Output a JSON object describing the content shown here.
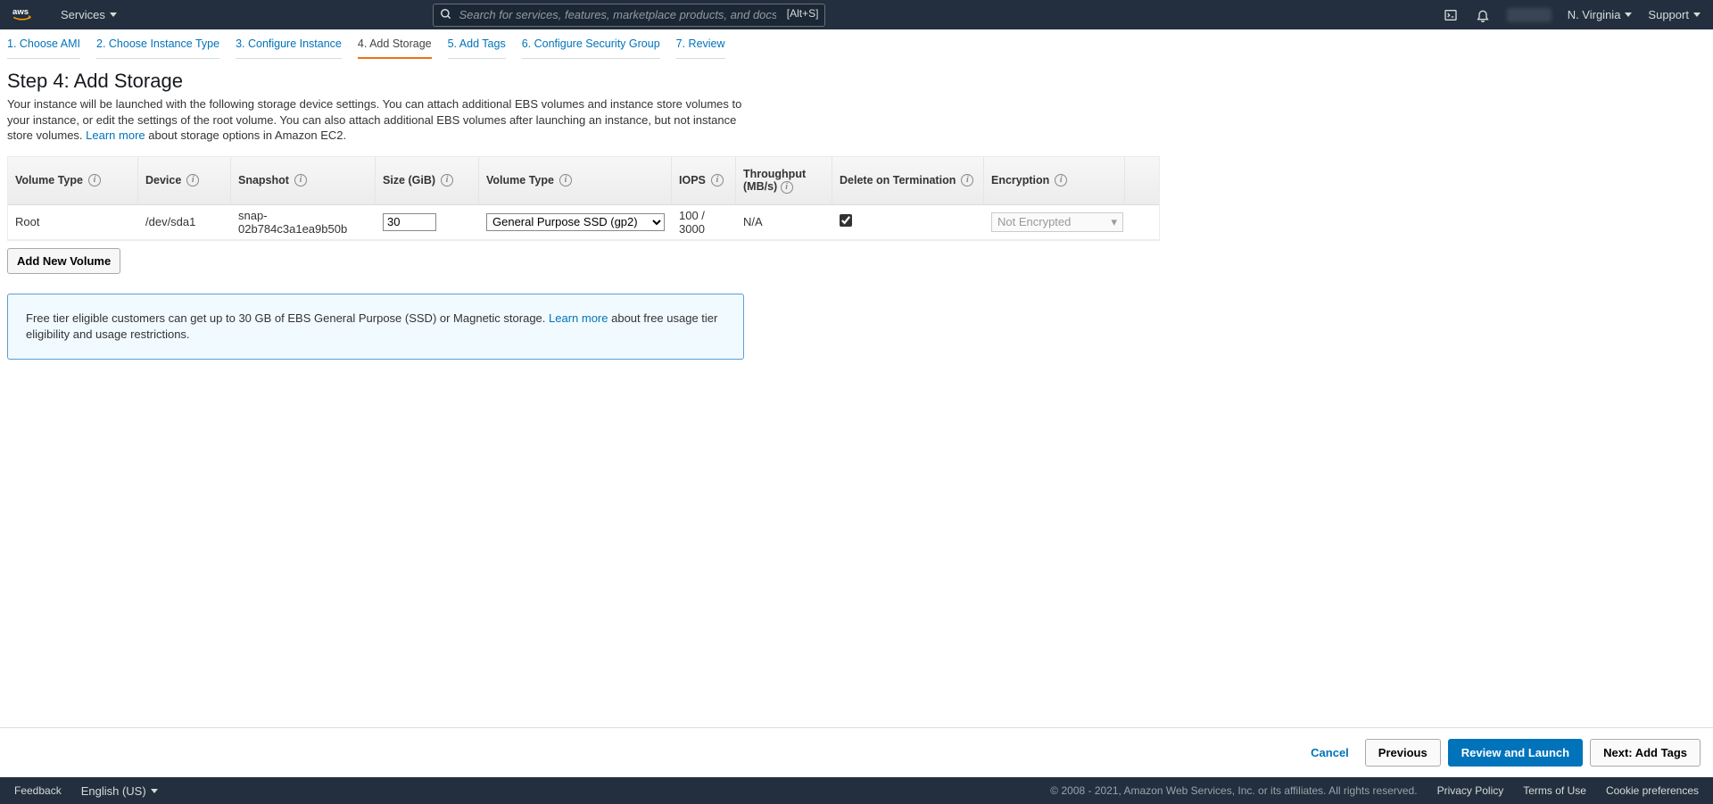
{
  "nav": {
    "services": "Services",
    "search_placeholder": "Search for services, features, marketplace products, and docs",
    "shortcut": "[Alt+S]",
    "region": "N. Virginia",
    "support": "Support"
  },
  "wizard": {
    "steps": [
      "1. Choose AMI",
      "2. Choose Instance Type",
      "3. Configure Instance",
      "4. Add Storage",
      "5. Add Tags",
      "6. Configure Security Group",
      "7. Review"
    ],
    "active_index": 3
  },
  "page": {
    "title": "Step 4: Add Storage",
    "lead_a": "Your instance will be launched with the following storage device settings. You can attach additional EBS volumes and instance store volumes to your instance, or edit the settings of the root volume. You can also attach additional EBS volumes after launching an instance, but not instance store volumes. ",
    "learn_more": "Learn more",
    "lead_b": " about storage options in Amazon EC2."
  },
  "table": {
    "headers": {
      "vt1": "Volume Type",
      "device": "Device",
      "snapshot": "Snapshot",
      "size": "Size (GiB)",
      "vt2": "Volume Type",
      "iops": "IOPS",
      "throughput_a": "Throughput",
      "throughput_b": "(MB/s)",
      "del": "Delete on Termination",
      "enc": "Encryption"
    },
    "row": {
      "vt1": "Root",
      "device": "/dev/sda1",
      "snapshot": "snap-02b784c3a1ea9b50b",
      "size": "30",
      "vt2": "General Purpose SSD (gp2)",
      "iops": "100 / 3000",
      "throughput": "N/A",
      "del_checked": true,
      "enc": "Not Encrypted"
    },
    "add_btn": "Add New Volume"
  },
  "infobox": {
    "text_a": "Free tier eligible customers can get up to 30 GB of EBS General Purpose (SSD) or Magnetic storage. ",
    "learn_more": "Learn more",
    "text_b": " about free usage tier eligibility and usage restrictions."
  },
  "actions": {
    "cancel": "Cancel",
    "previous": "Previous",
    "review": "Review and Launch",
    "next": "Next: Add Tags"
  },
  "footer": {
    "feedback": "Feedback",
    "language": "English (US)",
    "copyright": "© 2008 - 2021, Amazon Web Services, Inc. or its affiliates. All rights reserved.",
    "privacy": "Privacy Policy",
    "terms": "Terms of Use",
    "cookies": "Cookie preferences"
  }
}
